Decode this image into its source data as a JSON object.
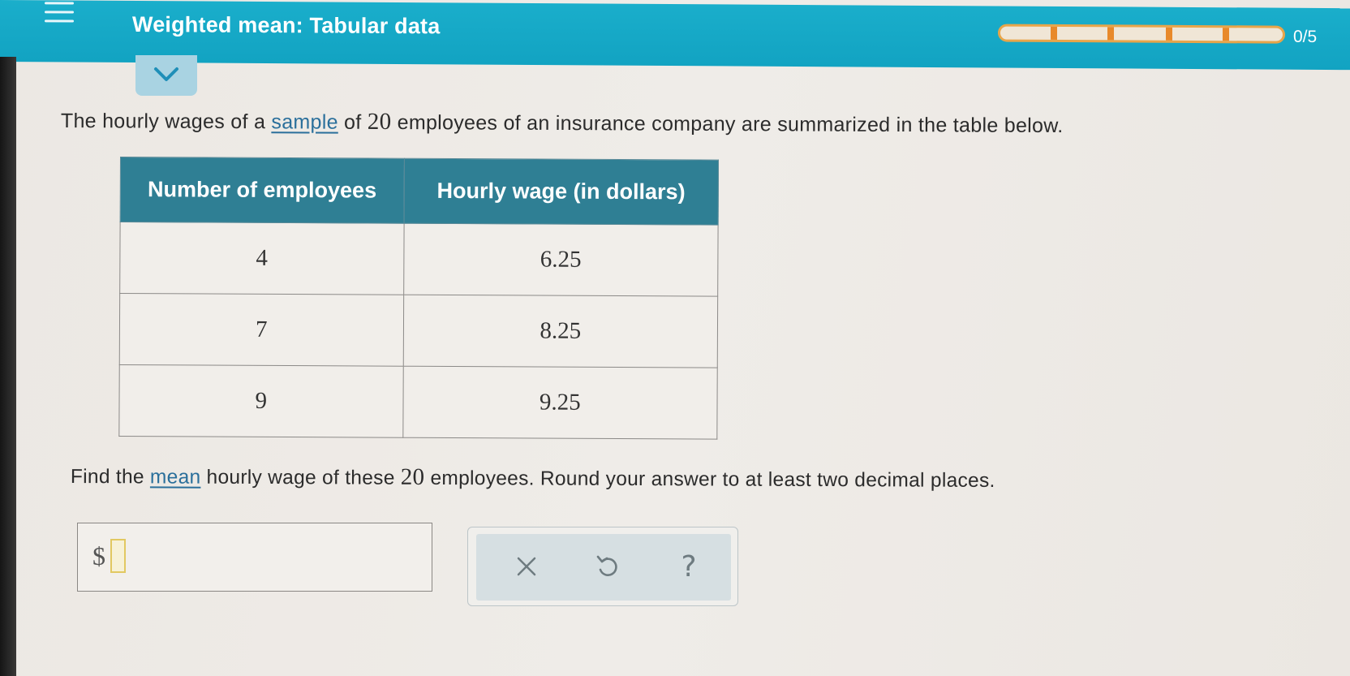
{
  "header": {
    "title": "Weighted mean: Tabular data",
    "progress_label": "0/5",
    "progress_fraction": 0,
    "accent_color": "#12a3c2",
    "progress_color": "#e8892a"
  },
  "problem": {
    "intro_prefix": "The hourly wages of a ",
    "intro_link": "sample",
    "intro_of": " of ",
    "intro_count": "20",
    "intro_suffix": " employees of an insurance company are summarized in the table below."
  },
  "table": {
    "headers": [
      "Number of employees",
      "Hourly wage (in dollars)"
    ],
    "rows": [
      [
        "4",
        "6.25"
      ],
      [
        "7",
        "8.25"
      ],
      [
        "9",
        "9.25"
      ]
    ]
  },
  "question": {
    "prefix": "Find the ",
    "link": "mean",
    "middle": " hourly wage of these ",
    "count": "20",
    "suffix": " employees. Round your answer to at least two decimal places."
  },
  "answer": {
    "currency_symbol": "$",
    "value": ""
  },
  "tools": {
    "clear_icon": "x-icon",
    "undo_icon": "undo-icon",
    "help_label": "?"
  }
}
